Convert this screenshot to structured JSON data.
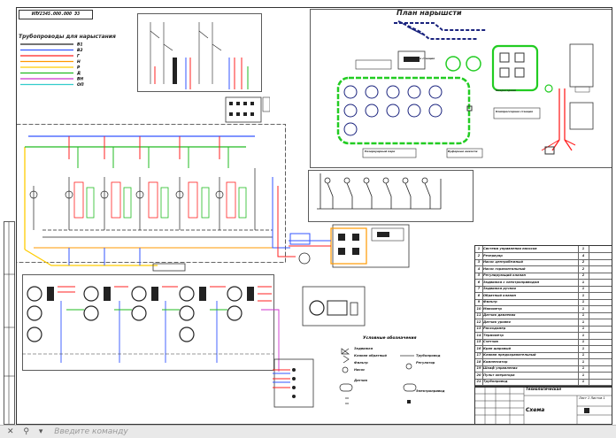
{
  "stamp": "ИПУ2345.000.000 Э3",
  "legend": {
    "title": "Трубопроводы для нарыстания",
    "items": [
      {
        "code": "В1",
        "color": "#222222"
      },
      {
        "code": "В2",
        "color": "#3355ff"
      },
      {
        "code": "Г",
        "color": "#ff2222"
      },
      {
        "code": "Н",
        "color": "#ff9900"
      },
      {
        "code": "Р",
        "color": "#ffcc00"
      },
      {
        "code": "Д",
        "color": "#22bb22"
      },
      {
        "code": "ВН",
        "color": "#cc33cc"
      },
      {
        "code": "ОП",
        "color": "#33cccc"
      }
    ]
  },
  "plan_title": "План нарышсти",
  "plan_notes": {
    "note1": "Насосная станция",
    "note2": "Компрессорная станция",
    "note3": "Резервуарный парк",
    "note4": "Буферные емкости",
    "note5": "Операторная"
  },
  "spec_table": {
    "rows": [
      {
        "no": "1",
        "name": "Система управления насосов",
        "qty": "1"
      },
      {
        "no": "2",
        "name": "Резервуар",
        "qty": "4"
      },
      {
        "no": "3",
        "name": "Насос центробежный",
        "qty": "2"
      },
      {
        "no": "4",
        "name": "Насос горизонтальный",
        "qty": "2"
      },
      {
        "no": "5",
        "name": "Регулирующий клапан",
        "qty": "2"
      },
      {
        "no": "6",
        "name": "Задвижка с электроприводом",
        "qty": "1"
      },
      {
        "no": "7",
        "name": "Задвижка ручная",
        "qty": "1"
      },
      {
        "no": "8",
        "name": "Обратный клапан",
        "qty": "1"
      },
      {
        "no": "9",
        "name": "Фильтр",
        "qty": "1"
      },
      {
        "no": "10",
        "name": "Манометр",
        "qty": "1"
      },
      {
        "no": "11",
        "name": "Датчик давления",
        "qty": "1"
      },
      {
        "no": "12",
        "name": "Датчик уровня",
        "qty": "1"
      },
      {
        "no": "13",
        "name": "Расходомер",
        "qty": "1"
      },
      {
        "no": "14",
        "name": "Термометр",
        "qty": "1"
      },
      {
        "no": "15",
        "name": "Счетчик",
        "qty": "1"
      },
      {
        "no": "16",
        "name": "Кран шаровый",
        "qty": "1"
      },
      {
        "no": "17",
        "name": "Клапан предохранительный",
        "qty": "1"
      },
      {
        "no": "18",
        "name": "Компенсатор",
        "qty": "1"
      },
      {
        "no": "19",
        "name": "Шкаф управления",
        "qty": "1"
      },
      {
        "no": "20",
        "name": "Пульт оператора",
        "qty": "1"
      },
      {
        "no": "21",
        "name": "Трубопровод",
        "qty": "1"
      }
    ]
  },
  "symbols": {
    "title": "Условные обозначения",
    "items": [
      "Задвижка",
      "Клапан обратный",
      "Фильтр",
      "Насос",
      "Датчик",
      "Трубопровод",
      "Регулятор",
      "Электропривод"
    ]
  },
  "title_block": {
    "name": "Схема",
    "sub": "Технологическая",
    "note": "Лист 1 Листов 1"
  },
  "command_line": {
    "placeholder": "Введите команду"
  }
}
